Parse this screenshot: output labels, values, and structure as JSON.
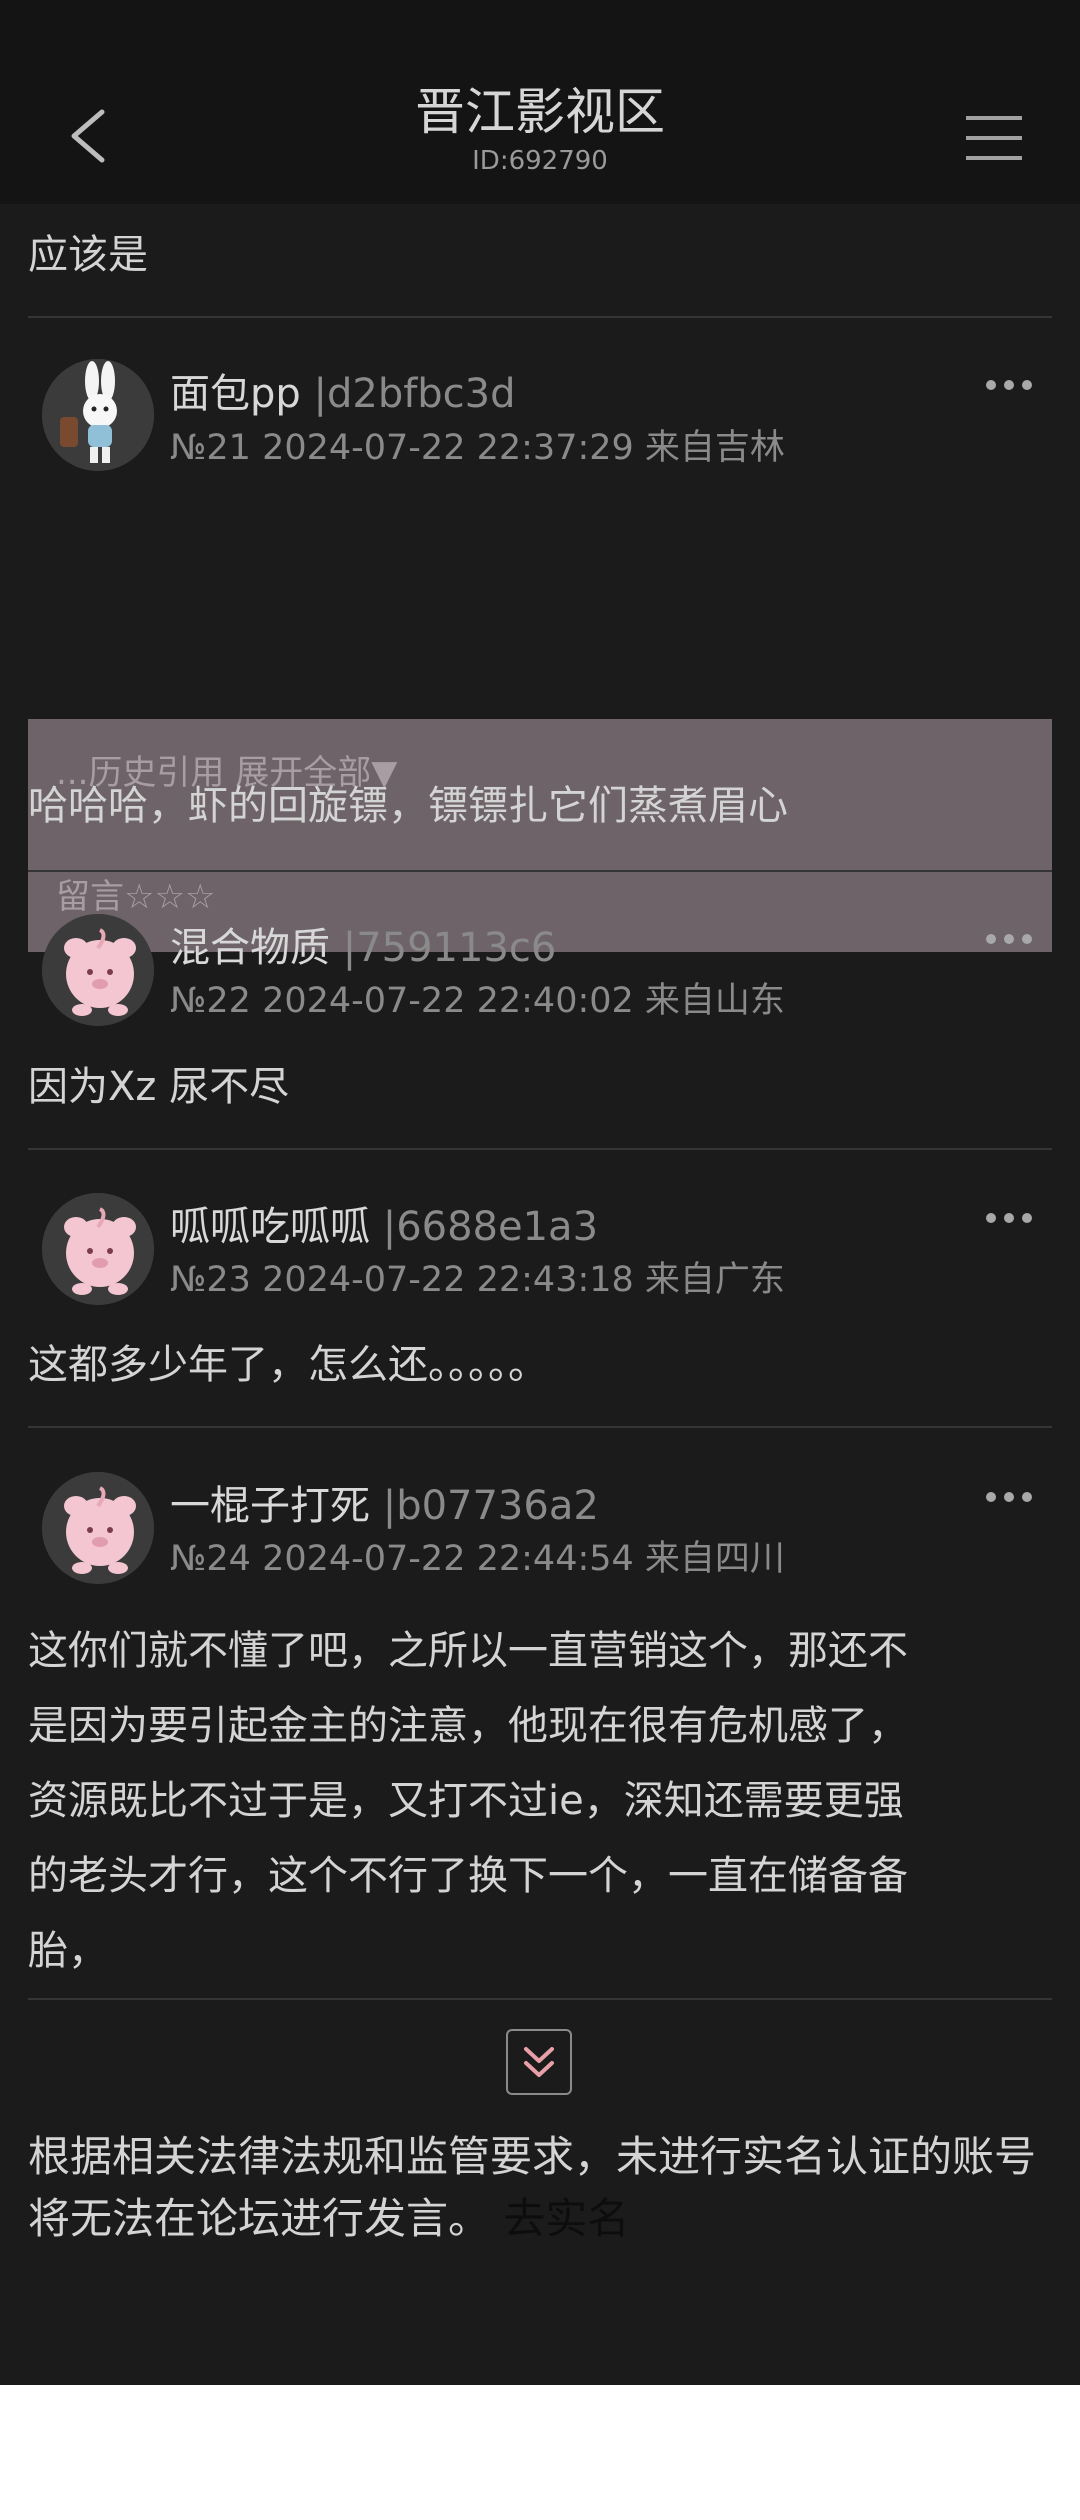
{
  "header": {
    "title": "晋江影视区",
    "subtitle": "ID:692790"
  },
  "top_post": {
    "text": "应该是"
  },
  "posts": [
    {
      "username": "面包pp",
      "uid": "|d2bfbc3d",
      "meta": "№21 2024-07-22 22:37:29 来自吉林",
      "quote_toggle": "...历史引用 展开全部▼",
      "quote_text": "留言☆☆☆",
      "body": "哈哈哈，虾的回旋镖，镖镖扎它们蒸煮眉心",
      "avatar_icon": "bunny-avatar"
    },
    {
      "username": "混合物质",
      "uid": "|759113c6",
      "meta": "№22 2024-07-22 22:40:02 来自山东",
      "body": "因为Xz 尿不尽",
      "avatar_icon": "pink-pig-avatar"
    },
    {
      "username": "呱呱吃呱呱",
      "uid": "|6688e1a3",
      "meta": "№23 2024-07-22 22:43:18 来自广东",
      "body": "这都多少年了，怎么还。。。。。",
      "avatar_icon": "pink-pig-avatar"
    },
    {
      "username": "一棍子打死",
      "uid": "|b07736a2",
      "meta": "№24 2024-07-22 22:44:54 来自四川",
      "body_lines": [
        "这你们就不懂了吧，之所以一直营销这个，那还不",
        "是因为要引起金主的注意，他现在很有危机感了，",
        "资源既比不过于是，又打不过ie，深知还需要更强",
        "的老头才行，这个不行了换下一个，一直在储备备",
        "胎，"
      ],
      "avatar_icon": "pink-pig-avatar"
    }
  ],
  "notice": {
    "text": "根据相关法律法规和监管要求，未进行实名认证的账号将无法在论坛进行发言。",
    "link": "去实名"
  },
  "colors": {
    "background": "#1b1b1b",
    "header": "#141414",
    "quote_bg": "#6d6368",
    "pig_pink": "#f3c6d2"
  }
}
